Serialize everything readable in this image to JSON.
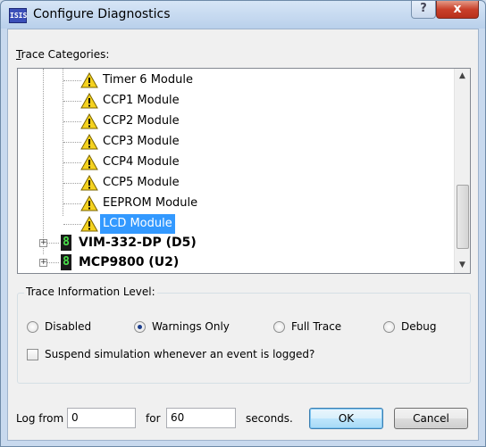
{
  "window": {
    "title": "Configure Diagnostics",
    "app_icon_text": "ISIS",
    "help_label": "?",
    "close_label": "x"
  },
  "trace": {
    "label_underline": "T",
    "label_rest": "race Categories:",
    "items": [
      {
        "label": "Timer 6 Module",
        "icon": "warning-icon"
      },
      {
        "label": "CCP1 Module",
        "icon": "warning-icon"
      },
      {
        "label": "CCP2 Module",
        "icon": "warning-icon"
      },
      {
        "label": "CCP3 Module",
        "icon": "warning-icon"
      },
      {
        "label": "CCP4 Module",
        "icon": "warning-icon"
      },
      {
        "label": "CCP5 Module",
        "icon": "warning-icon"
      },
      {
        "label": "EEPROM Module",
        "icon": "warning-icon"
      },
      {
        "label": "LCD Module",
        "icon": "warning-icon",
        "selected": true
      }
    ],
    "parents": [
      {
        "label": "VIM-332-DP (D5)",
        "icon": "chip-icon",
        "expander": "+",
        "chip_glyph": "8"
      },
      {
        "label": "MCP9800 (U2)",
        "icon": "chip-icon",
        "expander": "+",
        "chip_glyph": "8"
      }
    ],
    "scroll_up": "▲",
    "scroll_down": "▼"
  },
  "level": {
    "title": "Trace Information Level:",
    "options": [
      "Disabled",
      "Warnings Only",
      "Full Trace",
      "Debug"
    ],
    "selected": "Warnings Only",
    "suspend_label": "Suspend simulation whenever an event is logged?",
    "suspend_checked": false
  },
  "footer": {
    "log_from_label": "Log from",
    "log_from_value": "0",
    "for_label": "for",
    "for_value": "60",
    "seconds_label": "seconds.",
    "ok_label": "OK",
    "cancel_label": "Cancel"
  },
  "colors": {
    "selection": "#3399ff",
    "chip_text": "#4be04b",
    "warning": "#f5d21e"
  }
}
